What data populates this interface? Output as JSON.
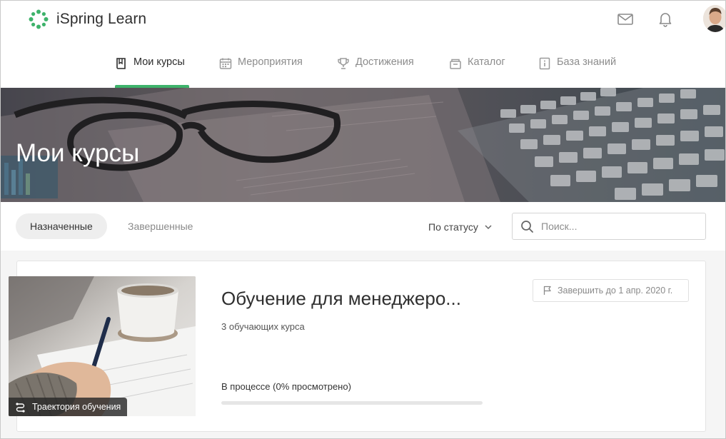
{
  "app": {
    "brand": "iSpring Learn",
    "accent_color": "#3eb36b",
    "header_icons": [
      "mail-icon",
      "bell-icon"
    ]
  },
  "nav": {
    "tabs": [
      {
        "label": "Мои курсы",
        "icon": "book-icon",
        "active": true
      },
      {
        "label": "Мероприятия",
        "icon": "calendar-icon",
        "active": false
      },
      {
        "label": "Достижения",
        "icon": "trophy-icon",
        "active": false
      },
      {
        "label": "Каталог",
        "icon": "catalog-icon",
        "active": false
      },
      {
        "label": "База знаний",
        "icon": "info-book-icon",
        "active": false
      }
    ]
  },
  "banner": {
    "title": "Мои курсы"
  },
  "filters": {
    "tabs": [
      {
        "label": "Назначенные",
        "active": true
      },
      {
        "label": "Завершенные",
        "active": false
      }
    ],
    "status_select": "По статусу",
    "search_placeholder": "Поиск..."
  },
  "course": {
    "title": "Обучение для менеджеро...",
    "subtitle": "3 обучающих курса",
    "badge": "Траектория обучения",
    "deadline": "Завершить до 1 апр. 2020 г.",
    "progress_text": "В процессе (0% просмотрено)",
    "progress_fraction": 0
  }
}
